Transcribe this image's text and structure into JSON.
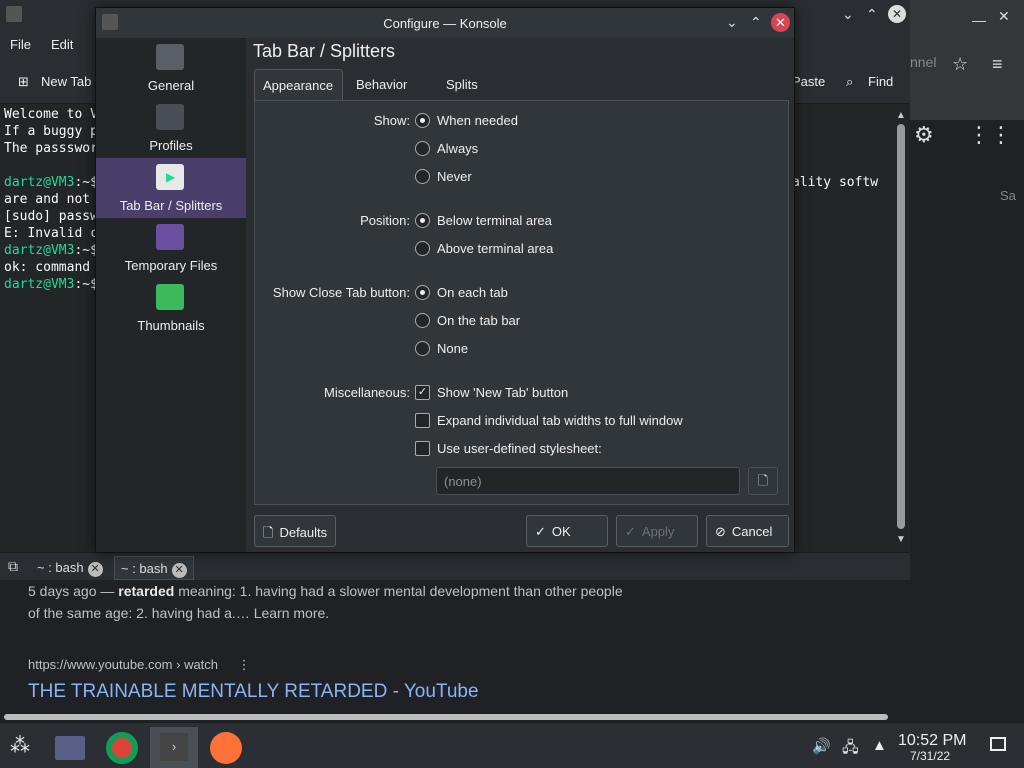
{
  "browser": {
    "snippet_line1_prefix": "5 days ago — ",
    "snippet_bold": "retarded",
    "snippet_line1_rest": " meaning: 1. having had a slower mental development than other people",
    "snippet_line2": "of the same age: 2. having had a.… Learn more.",
    "result_url": "https://www.youtube.com › watch",
    "result_title": "THE TRAINABLE MENTALLY RETARDED - YouTube",
    "partial_tab_text": "nnel",
    "partial_side_text": "Sa"
  },
  "konsole": {
    "menu": [
      "File",
      "Edit"
    ],
    "toolbar_new_tab": "New Tab",
    "toolbar_paste": "Paste",
    "toolbar_find": "Find",
    "terminal_lines": [
      {
        "prompt": "",
        "text": "Welcome to V"
      },
      {
        "prompt": "",
        "text": "If a buggy p"
      },
      {
        "prompt": "",
        "text": "The passswor"
      },
      {
        "prompt": "",
        "text": ""
      },
      {
        "prompt": "dartz@VM3",
        "text": ":~$"
      },
      {
        "prompt": "",
        "text": "are and not"
      },
      {
        "prompt": "",
        "text": "[sudo] passw"
      },
      {
        "prompt": "",
        "text": "E: Invalid c"
      },
      {
        "prompt": "dartz@VM3",
        "text": ":~$"
      },
      {
        "prompt": "",
        "text": "ok: command"
      },
      {
        "prompt": "dartz@VM3",
        "text": ":~$"
      }
    ],
    "terminal_right_fragment": "ality softw",
    "tabs": [
      {
        "label": "~ : bash"
      },
      {
        "label": "~ : bash"
      }
    ]
  },
  "dialog": {
    "title": "Configure — Konsole",
    "sidebar": [
      {
        "label": "General",
        "icon": "terminal-icon",
        "active": false
      },
      {
        "label": "Profiles",
        "icon": "profiles-icon",
        "active": false
      },
      {
        "label": "Tab Bar / Splitters",
        "icon": "tabbar-icon",
        "active": true
      },
      {
        "label": "Temporary Files",
        "icon": "folder-clock-icon",
        "active": false
      },
      {
        "label": "Thumbnails",
        "icon": "image-icon",
        "active": false
      }
    ],
    "page_title": "Tab Bar / Splitters",
    "tabs": [
      "Appearance",
      "Behavior",
      "Splits"
    ],
    "active_tab": "Appearance",
    "show_label": "Show:",
    "show_options": [
      "When needed",
      "Always",
      "Never"
    ],
    "show_selected": 0,
    "position_label": "Position:",
    "position_options": [
      "Below terminal area",
      "Above terminal area"
    ],
    "position_selected": 0,
    "close_label": "Show Close Tab button:",
    "close_options": [
      "On each tab",
      "On the tab bar",
      "None"
    ],
    "close_selected": 0,
    "misc_label": "Miscellaneous:",
    "misc_options": [
      {
        "label": "Show 'New Tab' button",
        "checked": true
      },
      {
        "label": "Expand individual tab widths to full window",
        "checked": false
      },
      {
        "label": "Use user-defined stylesheet:",
        "checked": false
      }
    ],
    "stylesheet_placeholder": "(none)",
    "btn_defaults": "Defaults",
    "btn_ok": "OK",
    "btn_apply": "Apply",
    "btn_cancel": "Cancel"
  },
  "taskbar": {
    "time": "10:52 PM",
    "date": "7/31/22"
  },
  "colors": {
    "accent": "#4a3f6b",
    "prompt": "#1cdc9a",
    "link": "#8ab4f8",
    "close": "#da4453"
  }
}
